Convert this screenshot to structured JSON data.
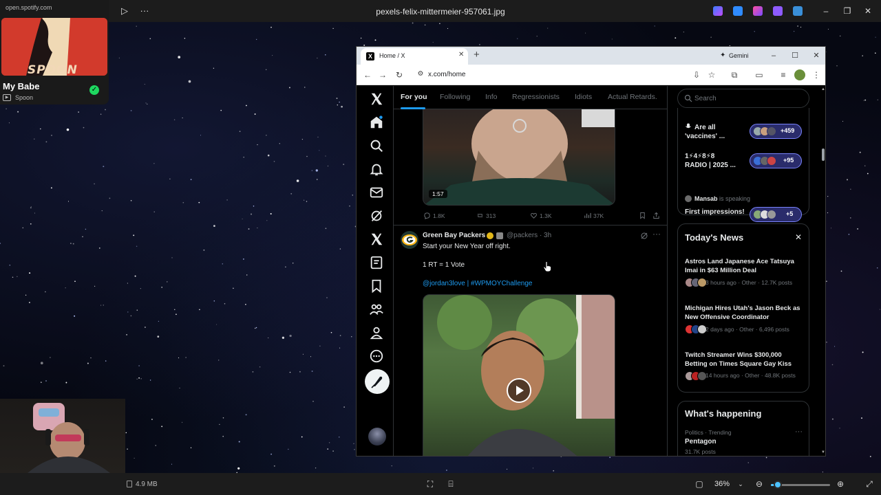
{
  "viewer": {
    "title": "pexels-felix-mittermeier-957061.jpg",
    "file_size": "4.9 MB",
    "zoom": "36%",
    "zoom_level_percent": 12
  },
  "spotify": {
    "url": "open.spotify.com",
    "album_art_text": "SPOON",
    "track_title": "My Babe",
    "artist": "Spoon",
    "accent": "#1ed760"
  },
  "browser": {
    "tab_title": "Home / X",
    "gemini_label": "Gemini",
    "url": "x.com/home"
  },
  "x": {
    "tabs": [
      {
        "label": "For you"
      },
      {
        "label": "Following"
      },
      {
        "label": "Info"
      },
      {
        "label": "Regressionists"
      },
      {
        "label": "Idiots"
      },
      {
        "label": "Actual Retards."
      }
    ],
    "post1": {
      "duration": "1:57",
      "replies": "1.8K",
      "reposts": "313",
      "likes": "1.3K",
      "views": "37K"
    },
    "post2": {
      "name": "Green Bay Packers",
      "handle": "@packers · 3h",
      "text1": "Start your New Year off right.",
      "text2": "1 RT = 1 Vote",
      "mention": "@jordan3love | #WPMOYChallenge"
    },
    "accent": "#1d9bf0"
  },
  "sidebar": {
    "search_placeholder": "Search",
    "spaces": [
      {
        "title1": "Are all",
        "title2": "'vaccines' ...",
        "count": "+459"
      },
      {
        "title1": "1⚡4⚡8⚡8",
        "title2": "RADIO | 2025 ...",
        "count": "+95"
      },
      {
        "speaker": "Mansab",
        "status": " is speaking",
        "title1": "First impressions!",
        "count": "+5"
      }
    ],
    "news_title": "Today's News",
    "news": [
      {
        "headline": "Astros Land Japanese Ace Tatsuya Imai in $63 Million Deal",
        "meta": "3 hours ago · Other · 12.7K posts"
      },
      {
        "headline": "Michigan Hires Utah's Jason Beck as New Offensive Coordinator",
        "meta": "2 days ago · Other · 6,496 posts"
      },
      {
        "headline": "Twitch Streamer Wins $300,000 Betting on Times Square Gay Kiss",
        "meta": "14 hours ago · Other · 48.8K posts"
      }
    ],
    "happening_title": "What's happening",
    "trend_context": "Politics · Trending",
    "trend_name": "Pentagon",
    "trend_count": "31.7K posts"
  }
}
